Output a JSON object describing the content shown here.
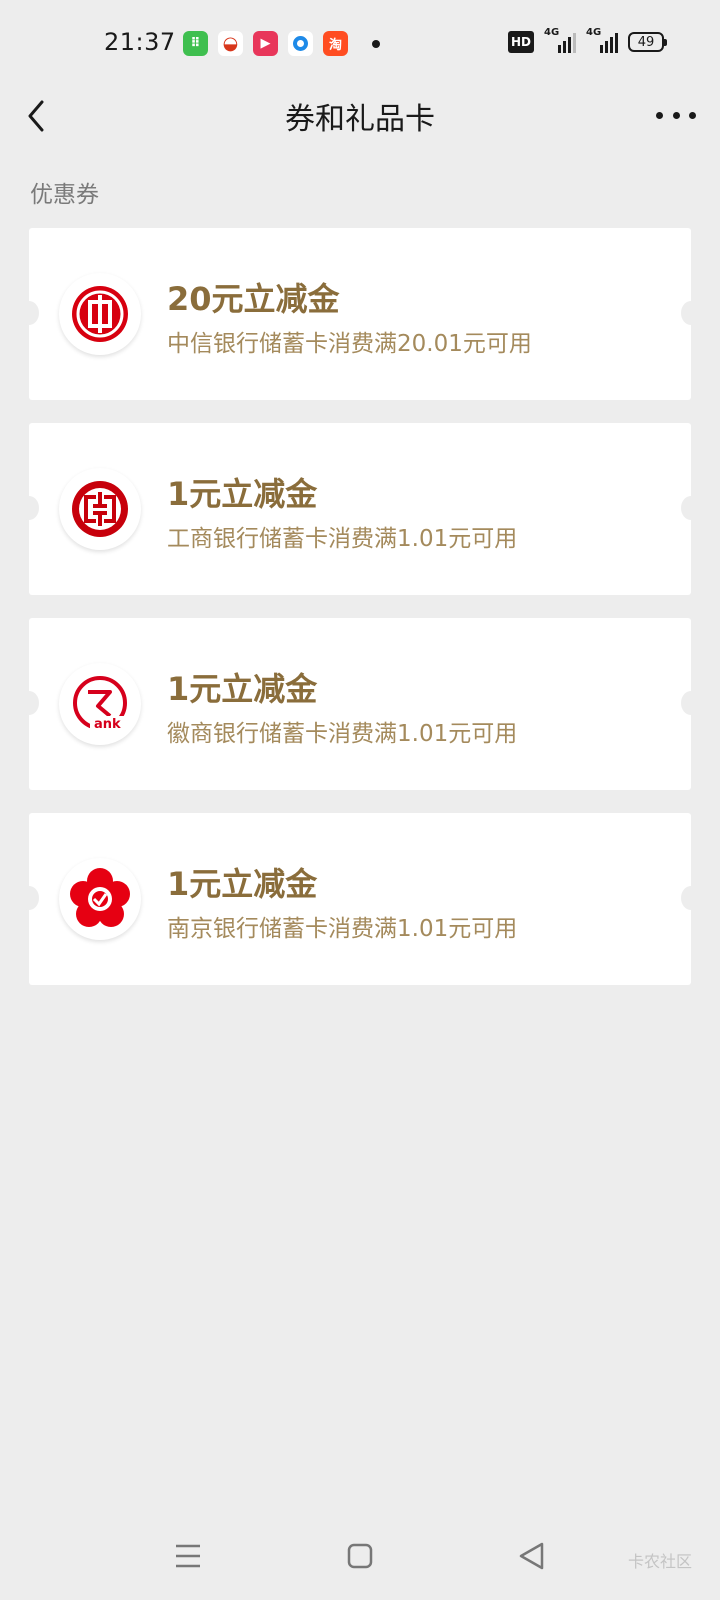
{
  "status_bar": {
    "time": "21:37",
    "notifications": [
      "app-icon-green",
      "app-icon-taobao-orange",
      "app-icon-video-pink",
      "app-icon-blue-ring",
      "app-icon-taobao-red"
    ],
    "network_badge": "HD",
    "signal1_label": "4G",
    "signal2_label": "4G",
    "battery": "49"
  },
  "nav": {
    "title": "券和礼品卡"
  },
  "section": {
    "label": "优惠券"
  },
  "coupons": [
    {
      "title": "20元立减金",
      "desc": "中信银行储蓄卡消费满20.01元可用",
      "logo": "citic-bank-logo",
      "logo_color": "#d7000f"
    },
    {
      "title": "1元立减金",
      "desc": "工商银行储蓄卡消费满1.01元可用",
      "logo": "icbc-bank-logo",
      "logo_color": "#c7000b"
    },
    {
      "title": "1元立减金",
      "desc": "徽商银行储蓄卡消费满1.01元可用",
      "logo": "huishang-bank-logo",
      "logo_color": "#d6001c"
    },
    {
      "title": "1元立减金",
      "desc": "南京银行储蓄卡消费满1.01元可用",
      "logo": "nanjing-bank-logo",
      "logo_color": "#e60012"
    }
  ],
  "huishang_logo_text": "ank",
  "watermark": "卡农社区",
  "colors": {
    "background": "#ededed",
    "card": "#ffffff",
    "title_gold": "#8a6d3b",
    "desc_gold": "#a48a5c"
  }
}
